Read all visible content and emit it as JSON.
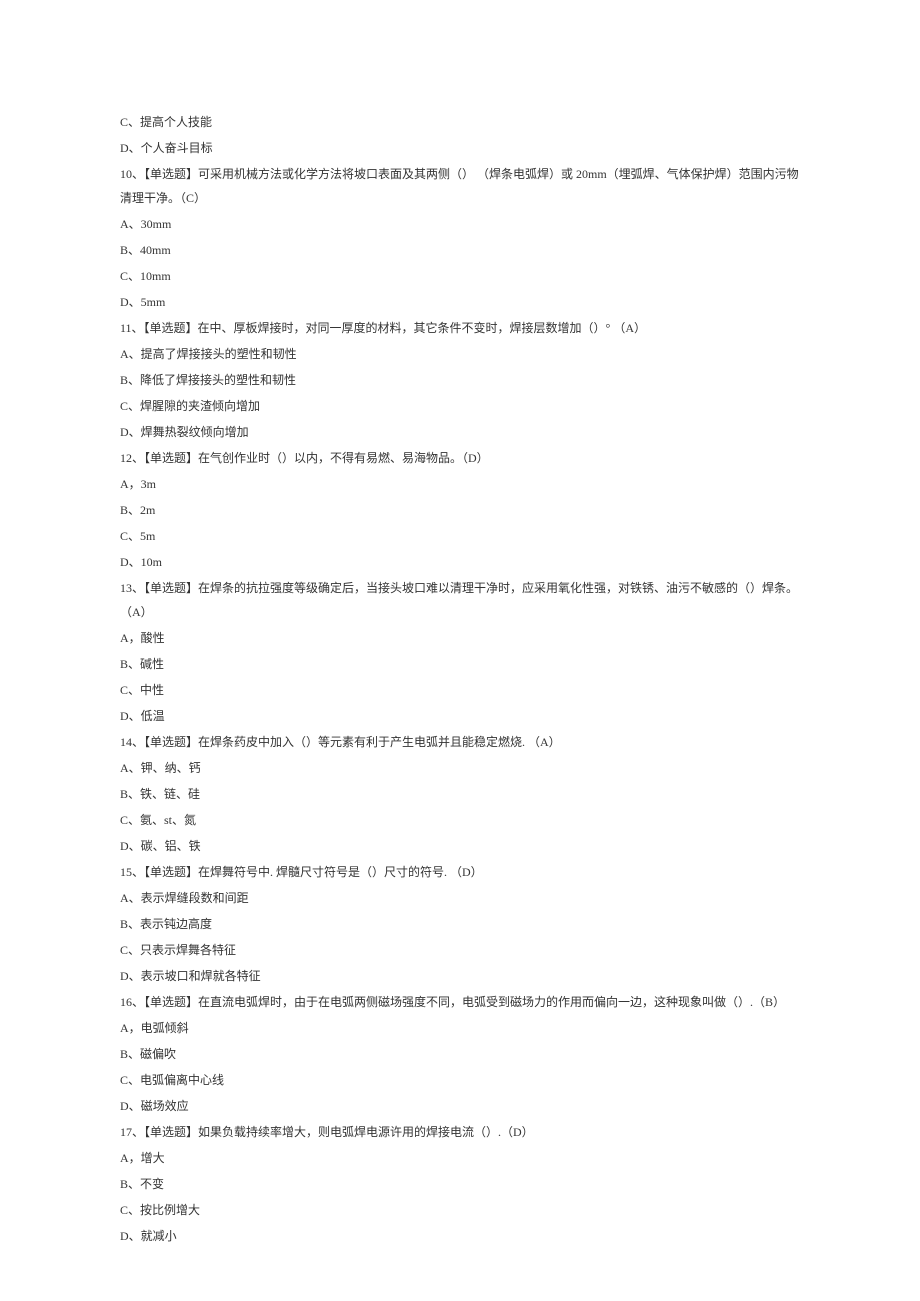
{
  "lines": [
    "C、提高个人技能",
    "D、个人奋斗目标",
    "10、【单选题】可采用机械方法或化学方法将坡口表面及其两侧（） （焊条电弧焊）或 20mm（埋弧焊、气体保护焊）范围内污物清理干净。（C）",
    "A、30mm",
    "B、40mm",
    "C、10mm",
    "D、5mm",
    "11、【单选题】在中、厚板焊接时，对同一厚度的材料，其它条件不变时，焊接层数增加（）° （A）",
    "A、提高了焊接接头的塑性和韧性",
    "B、降低了焊接接头的塑性和韧性",
    "C、焊腥隙的夹渣倾向增加",
    "D、焊舞热裂纹倾向增加",
    "12、【单选题】在气创作业时（）以内，不得有易燃、易海物品。（D）",
    "A，3m",
    "B、2m",
    "C、5m",
    "D、10m",
    "13、【单选题】在焊条的抗拉强度等级确定后，当接头坡口难以清理干净时，应采用氧化性强，对铁锈、油污不敏感的（）焊条。（A）",
    "A，酸性",
    "B、碱性",
    "C、中性",
    "D、低温",
    "14、【单选题】在焊条药皮中加入（）等元素有利于产生电弧并且能稳定燃烧. （A）",
    "A、钾、纳、钙",
    "B、铁、链、硅",
    "C、氨、st、氮",
    "D、碳、铝、铁",
    "15、【单选题】在焊舞符号中. 焊髓尺寸符号是（）尺寸的符号. （D）",
    "A、表示焊缝段数和间距",
    "B、表示钝边高度",
    "C、只表示焊舞各特征",
    "D、表示坡口和焊就各特征",
    "16、【单选题】在直流电弧焊时，由于在电弧两侧磁场强度不同，电弧受到磁场力的作用而偏向一边，这种现象叫做（）.（B）",
    "A，电弧倾斜",
    "B、磁偏吹",
    "C、电弧偏离中心线",
    "D、磁场效应",
    "17、【单选题】如果负载持续率增大，则电弧焊电源许用的焊接电流（）.（D）",
    "A，增大",
    "B、不变",
    "C、按比例增大",
    "D、就减小"
  ]
}
